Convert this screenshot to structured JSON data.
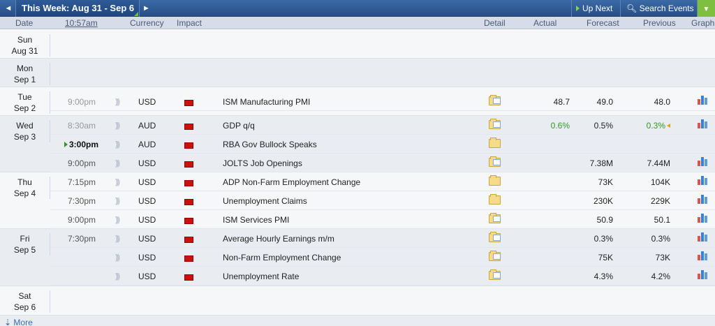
{
  "toolbar": {
    "week_label": "This Week: Aug 31 - Sep 6",
    "up_next": "Up Next",
    "search_events": "Search Events",
    "prev_icon": "◄",
    "next_icon": "►",
    "filter_icon": "▼"
  },
  "columns": {
    "date": "Date",
    "time": "10:57am",
    "currency": "Currency",
    "impact": "Impact",
    "detail": "Detail",
    "actual": "Actual",
    "forecast": "Forecast",
    "previous": "Previous",
    "graph": "Graph"
  },
  "days": [
    {
      "dow": "Sun",
      "date": "Aug 31"
    },
    {
      "dow": "Mon",
      "date": "Sep 1"
    },
    {
      "dow": "Tue",
      "date": "Sep 2"
    },
    {
      "dow": "Wed",
      "date": "Sep 3"
    },
    {
      "dow": "Thu",
      "date": "Sep 4"
    },
    {
      "dow": "Fri",
      "date": "Sep 5"
    },
    {
      "dow": "Sat",
      "date": "Sep 6"
    }
  ],
  "events": [
    {
      "time": "9:00pm",
      "currency": "USD",
      "event": "ISM Manufacturing PMI",
      "actual": "48.7",
      "forecast": "49.0",
      "previous": "48.0"
    },
    {
      "time": "8:30am",
      "currency": "AUD",
      "event": "GDP q/q",
      "actual": "0.6%",
      "forecast": "0.5%",
      "previous": "0.3%"
    },
    {
      "time": "3:00pm",
      "currency": "AUD",
      "event": "RBA Gov Bullock Speaks",
      "actual": "",
      "forecast": "",
      "previous": ""
    },
    {
      "time": "9:00pm",
      "currency": "USD",
      "event": "JOLTS Job Openings",
      "actual": "",
      "forecast": "7.38M",
      "previous": "7.44M"
    },
    {
      "time": "7:15pm",
      "currency": "USD",
      "event": "ADP Non-Farm Employment Change",
      "actual": "",
      "forecast": "73K",
      "previous": "104K"
    },
    {
      "time": "7:30pm",
      "currency": "USD",
      "event": "Unemployment Claims",
      "actual": "",
      "forecast": "230K",
      "previous": "229K"
    },
    {
      "time": "9:00pm",
      "currency": "USD",
      "event": "ISM Services PMI",
      "actual": "",
      "forecast": "50.9",
      "previous": "50.1"
    },
    {
      "time": "7:30pm",
      "currency": "USD",
      "event": "Average Hourly Earnings m/m",
      "actual": "",
      "forecast": "0.3%",
      "previous": "0.3%"
    },
    {
      "time": "",
      "currency": "USD",
      "event": "Non-Farm Employment Change",
      "actual": "",
      "forecast": "75K",
      "previous": "73K"
    },
    {
      "time": "",
      "currency": "USD",
      "event": "Unemployment Rate",
      "actual": "",
      "forecast": "4.3%",
      "previous": "4.2%"
    }
  ],
  "more": "More",
  "colors": {
    "toolbar": "#2e5a96",
    "accent_green": "#7fbf3f",
    "high_impact": "#cc1010",
    "better_than_forecast": "#2f9a22"
  }
}
